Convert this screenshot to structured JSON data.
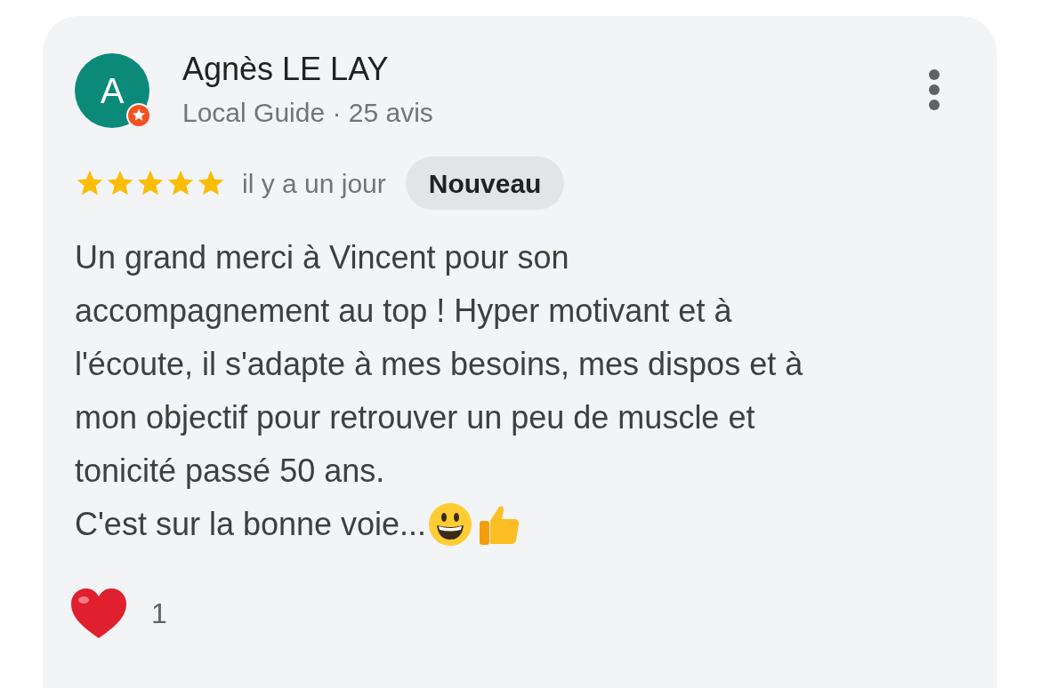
{
  "review": {
    "avatar_letter": "A",
    "author": "Agnès LE LAY",
    "subtitle": "Local Guide · 25 avis",
    "stars": 5,
    "time": "il y a un jour",
    "badge": "Nouveau",
    "text_lines": [
      "Un grand merci à Vincent pour son",
      "accompagnement au top ! Hyper motivant et à",
      "l'écoute, il s'adapte à mes besoins, mes dispos et à",
      "mon objectif pour retrouver un peu de muscle et",
      "tonicité passé 50 ans.",
      "C'est sur la bonne voie..."
    ],
    "reaction_count": "1"
  }
}
